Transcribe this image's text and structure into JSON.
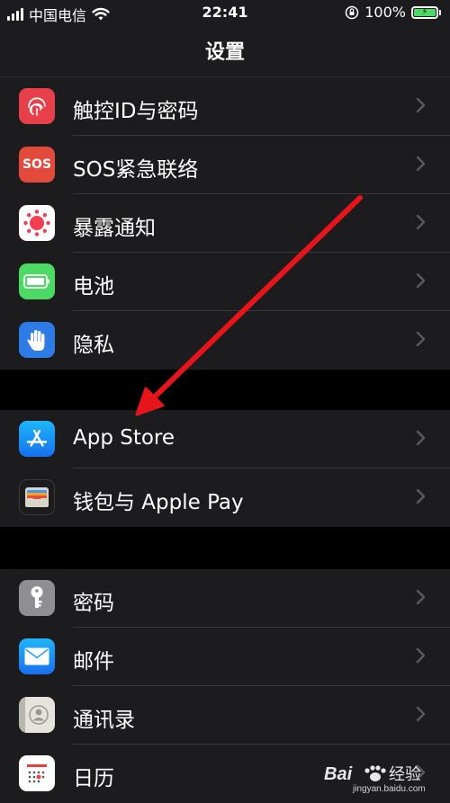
{
  "status_bar": {
    "carrier": "中国电信",
    "time": "22:41",
    "battery": "100%",
    "icons": [
      "signal-icon",
      "wifi-icon",
      "orientation-lock-icon",
      "battery-charging-icon"
    ]
  },
  "nav": {
    "title": "设置"
  },
  "groups": [
    {
      "items": [
        {
          "label": "触控ID与密码",
          "icon": "fingerprint-icon",
          "color": "#e8404a"
        },
        {
          "label": "SOS紧急联络",
          "icon": "sos-icon",
          "icon_text": "SOS",
          "color": "#e44a3c"
        },
        {
          "label": "暴露通知",
          "icon": "exposure-icon",
          "color": "#ffffff"
        },
        {
          "label": "电池",
          "icon": "battery-icon",
          "color": "#4cd964"
        },
        {
          "label": "隐私",
          "icon": "hand-icon",
          "color": "#2d7be5"
        }
      ]
    },
    {
      "items": [
        {
          "label": "App Store",
          "icon": "app-store-icon",
          "color": "#1d8cf8"
        },
        {
          "label": "钱包与 Apple Pay",
          "icon": "wallet-icon",
          "color": "#1c1c1e"
        }
      ]
    },
    {
      "items": [
        {
          "label": "密码",
          "icon": "key-icon",
          "color": "#8e8e93"
        },
        {
          "label": "邮件",
          "icon": "mail-icon",
          "color": "#2e8cf0"
        },
        {
          "label": "通讯录",
          "icon": "contacts-icon",
          "color": "#c9c6c0"
        },
        {
          "label": "日历",
          "icon": "calendar-icon",
          "color": "#ffffff"
        }
      ]
    }
  ],
  "watermark": {
    "brand": "Bai",
    "brand2": "经验",
    "url": "jingyan.baidu.com"
  },
  "annotation": {
    "type": "arrow",
    "color": "#e8141b"
  }
}
